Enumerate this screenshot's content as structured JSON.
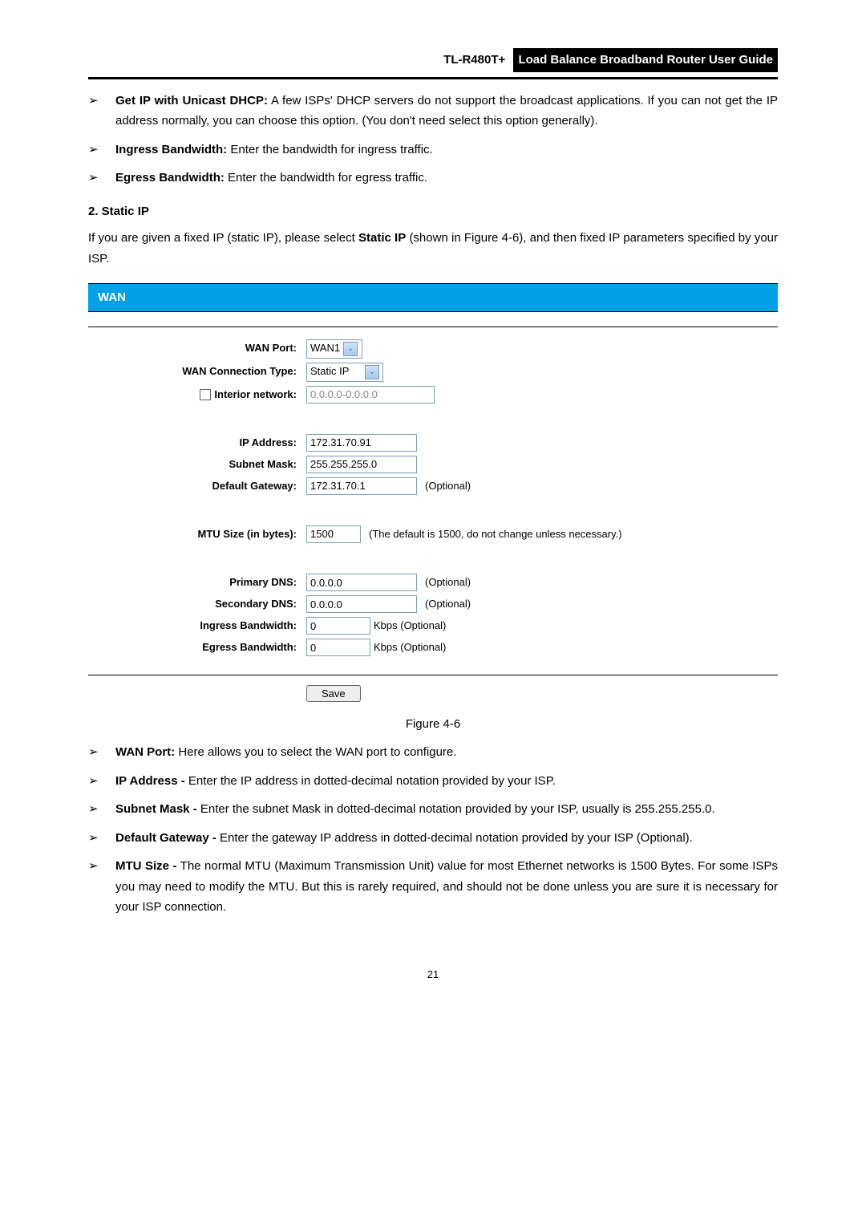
{
  "header": {
    "model": "TL-R480T+",
    "title": "Load Balance Broadband Router User Guide"
  },
  "top_bullets": [
    {
      "bold": "Get IP with Unicast DHCP:",
      "rest": " A few ISPs' DHCP servers do not support the broadcast applications. If you can not get the IP address normally, you can choose this option. (You don't need select this option generally)."
    },
    {
      "bold": "Ingress Bandwidth:",
      "rest": " Enter the bandwidth for ingress traffic."
    },
    {
      "bold": "Egress Bandwidth:",
      "rest": " Enter the bandwidth for egress traffic."
    }
  ],
  "section_number": "2.    Static IP",
  "intro_para_pre": "If you are given a fixed IP (static IP), please select ",
  "intro_para_bold": "Static IP",
  "intro_para_post": " (shown in Figure 4-6), and then fixed IP parameters specified by your ISP.",
  "wan_panel": {
    "heading": "WAN",
    "labels": {
      "wan_port": "WAN Port:",
      "conn_type": "WAN Connection Type:",
      "interior": "Interior network:",
      "ip": "IP Address:",
      "mask": "Subnet Mask:",
      "gateway": "Default Gateway:",
      "mtu": "MTU Size (in bytes):",
      "pdns": "Primary DNS:",
      "sdns": "Secondary DNS:",
      "ingress": "Ingress Bandwidth:",
      "egress": "Egress Bandwidth:"
    },
    "values": {
      "wan_port": "WAN1",
      "conn_type": "Static IP",
      "interior": "0.0.0.0-0.0.0.0",
      "ip": "172.31.70.91",
      "mask": "255.255.255.0",
      "gateway": "172.31.70.1",
      "mtu": "1500",
      "pdns": "0.0.0.0",
      "sdns": "0.0.0.0",
      "ingress": "0",
      "egress": "0"
    },
    "hints": {
      "optional": "(Optional)",
      "mtu": "(The default is 1500, do not change unless necessary.)",
      "kbps": "Kbps (Optional)"
    },
    "save": "Save"
  },
  "figure_caption": "Figure 4-6",
  "bottom_bullets": [
    {
      "bold": "WAN Port:",
      "rest": " Here allows you to select the WAN port to configure."
    },
    {
      "bold": "IP Address -",
      "rest": " Enter the IP address in dotted-decimal notation provided by your ISP."
    },
    {
      "bold": "Subnet Mask -",
      "rest": " Enter the subnet Mask in dotted-decimal notation provided by your ISP, usually is 255.255.255.0."
    },
    {
      "bold": "Default Gateway -",
      "rest": " Enter the gateway IP address in dotted-decimal notation provided by your ISP (Optional)."
    },
    {
      "bold": "MTU Size -",
      "rest": " The normal MTU (Maximum Transmission Unit) value for most Ethernet networks is 1500 Bytes. For some ISPs you may need to modify the MTU. But this is rarely required, and should not be done unless you are sure it is necessary for your ISP connection."
    }
  ],
  "page_number": "21"
}
